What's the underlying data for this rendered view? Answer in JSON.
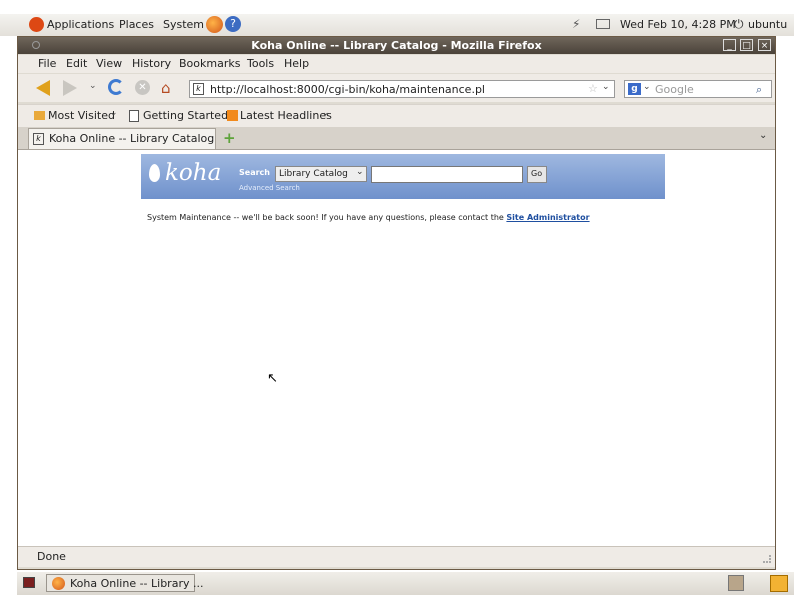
{
  "panel": {
    "applications": "Applications",
    "places": "Places",
    "system": "System",
    "clock": "Wed Feb 10,  4:28 PM",
    "user": "ubuntu"
  },
  "window": {
    "title": "Koha Online -- Library Catalog - Mozilla Firefox"
  },
  "menu": {
    "file": "File",
    "edit": "Edit",
    "view": "View",
    "history": "History",
    "bookmarks": "Bookmarks",
    "tools": "Tools",
    "help": "Help"
  },
  "nav": {
    "url": "http://localhost:8000/cgi-bin/koha/maintenance.pl",
    "search_placeholder": "Google"
  },
  "bookmarks": {
    "most_visited": "Most Visited",
    "getting_started": "Getting Started",
    "latest_headlines": "Latest Headlines"
  },
  "tab": {
    "label": "Koha Online -- Library Catalog"
  },
  "koha": {
    "logo": "koha",
    "search_label": "Search",
    "catalog_option": "Library Catalog",
    "go_label": "Go",
    "advanced_search": "Advanced Search"
  },
  "page": {
    "message": "System Maintenance -- we'll be back soon! If you have any questions, please contact the",
    "link": "Site Administrator"
  },
  "status": {
    "text": "Done"
  },
  "taskbar": {
    "window_label": "Koha Online -- Library ..."
  },
  "colors": {
    "ubuntu_orange": "#dd4814",
    "koha_blue": "#7f9fd4",
    "link_blue": "#1f4fa0"
  }
}
